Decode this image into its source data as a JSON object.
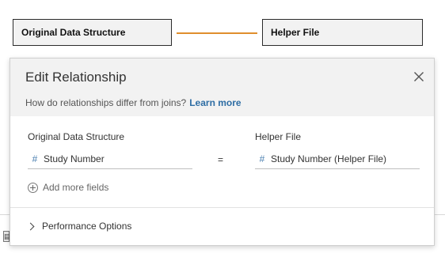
{
  "canvas": {
    "left_table": "Original Data Structure",
    "right_table": "Helper File",
    "noodle_color": "#e08e2d"
  },
  "dialog": {
    "title": "Edit Relationship",
    "help_text": "How do relationships differ from joins?",
    "help_link": "Learn more",
    "left_label": "Original Data Structure",
    "right_label": "Helper File",
    "left_field": "Study Number",
    "right_field": "Study Number (Helper File)",
    "operator": "=",
    "add_more": "Add more fields",
    "performance": "Performance Options",
    "field_type_icon": "number-hash-icon",
    "link_color": "#2e6da4"
  }
}
